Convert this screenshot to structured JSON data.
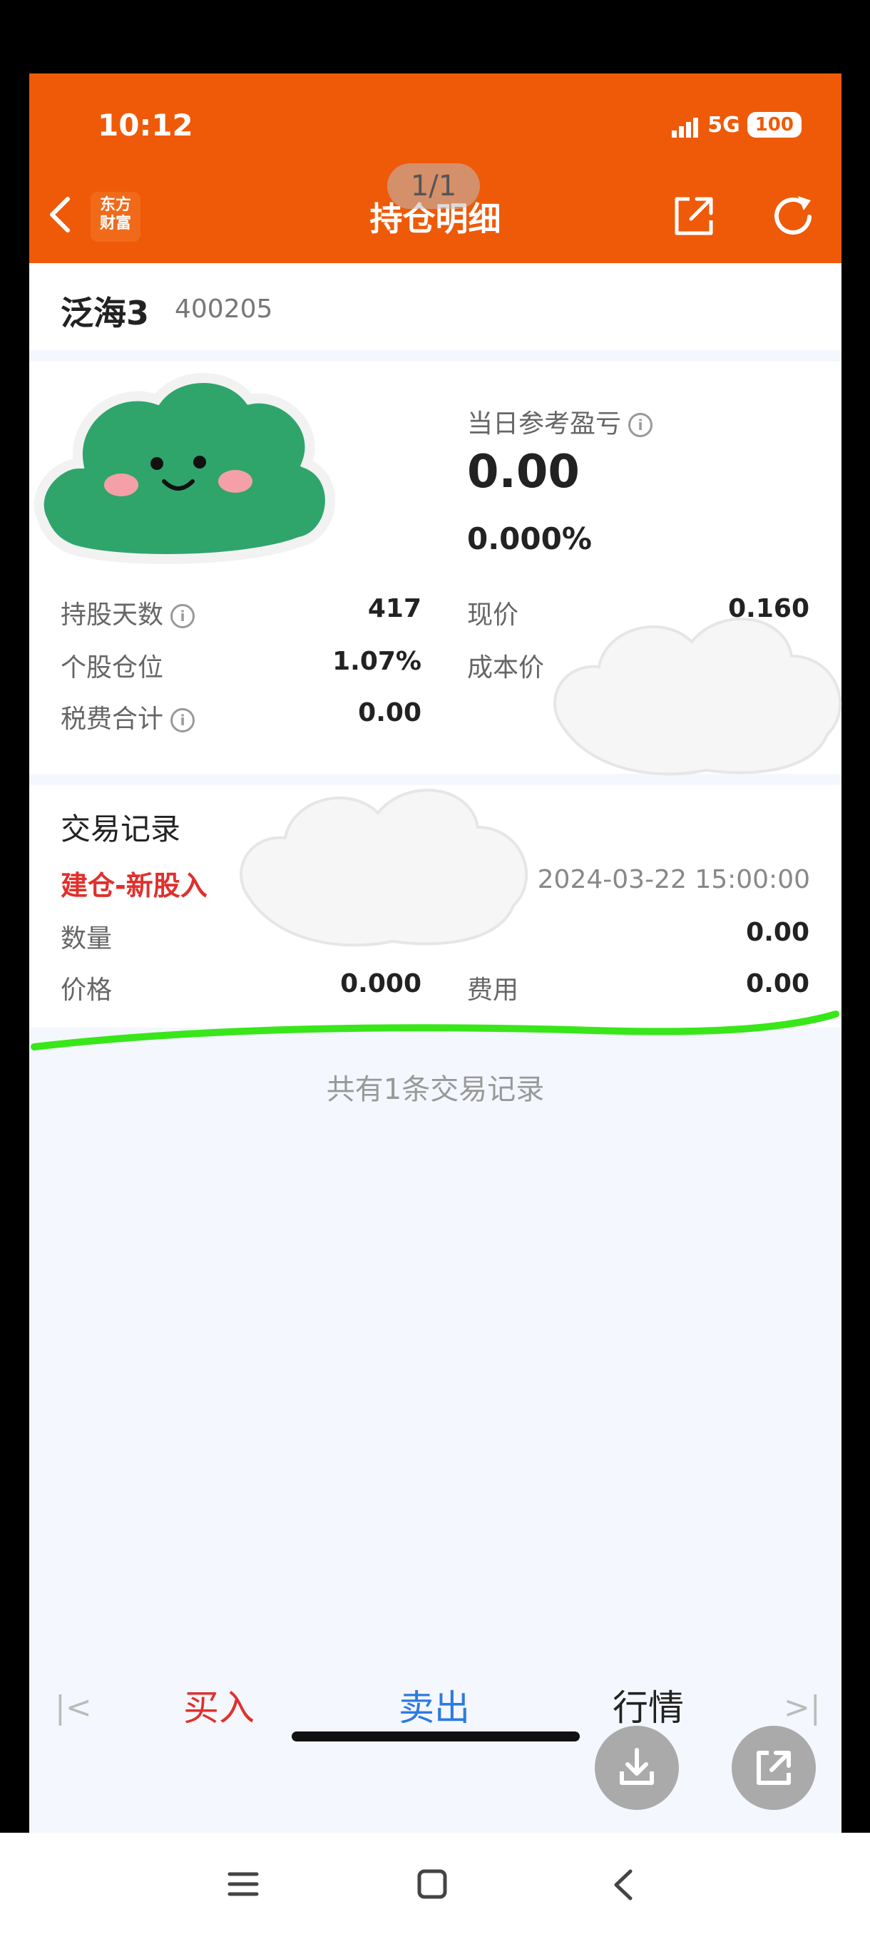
{
  "status_bar": {
    "time": "10:12",
    "network": "5G",
    "battery": "100"
  },
  "header": {
    "logo_line1": "东方",
    "logo_line2": "财富",
    "title": "持仓明细",
    "page_indicator": "1/1"
  },
  "stock": {
    "name": "泛海3",
    "code": "400205"
  },
  "pnl": {
    "label": "当日参考盈亏",
    "value": "0.00",
    "percent": "0.000%"
  },
  "stats": {
    "hold_days_label": "持股天数",
    "hold_days_value": "417",
    "position_ratio_label": "个股仓位",
    "position_ratio_value": "1.07%",
    "tax_fee_label": "税费合计",
    "tax_fee_value": "0.00",
    "current_price_label": "现价",
    "current_price_value": "0.160",
    "cost_price_label": "成本价"
  },
  "trade_records": {
    "title": "交易记录",
    "type": "建仓-新股入",
    "datetime": "2024-03-22 15:00:00",
    "quantity_label": "数量",
    "amount_value": "0.00",
    "price_label": "价格",
    "price_value": "0.000",
    "fee_label": "费用",
    "fee_value": "0.00",
    "summary": "共有1条交易记录"
  },
  "actions": {
    "buy": "买入",
    "sell": "卖出",
    "market": "行情"
  },
  "colors": {
    "brand_orange": "#ef5a08",
    "buy_red": "#e0302c",
    "sell_blue": "#2c7be0",
    "marker_green": "#39e61a"
  }
}
